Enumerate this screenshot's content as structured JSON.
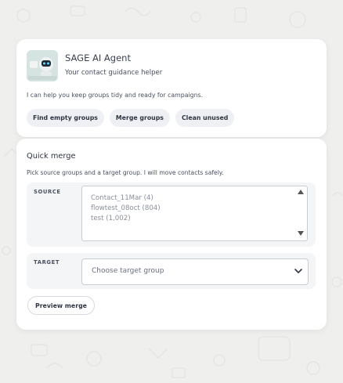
{
  "agent": {
    "name": "SAGE AI Agent",
    "subtitle": "Your contact guidance helper",
    "intro": "I can help you keep groups tidy and ready for campaigns.",
    "chips": [
      "Find empty groups",
      "Merge groups",
      "Clean unused"
    ]
  },
  "quick_merge": {
    "title": "Quick merge",
    "description": "Pick source groups and a target group. I will move contacts safely.",
    "source_label": "SOURCE",
    "source_options": [
      "Contact_11Mar (4)",
      "flowtest_08oct (804)",
      "test (1,002)"
    ],
    "target_label": "TARGET",
    "target_placeholder": "Choose target group",
    "preview_label": "Preview merge"
  },
  "colors": {
    "background": "#efefed",
    "card": "#ffffff",
    "chip": "#eef0f4",
    "panel": "#f4f5f7",
    "text": "#2f3542"
  },
  "icons": [
    "robot-avatar-icon",
    "scroll-up-icon",
    "scroll-down-icon",
    "chevron-down-icon"
  ]
}
